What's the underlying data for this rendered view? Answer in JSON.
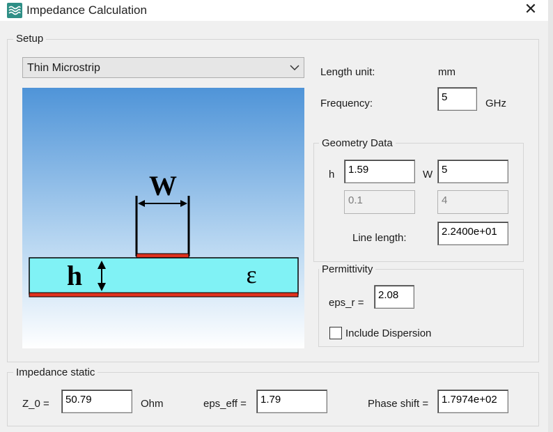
{
  "window": {
    "title": "Impedance Calculation",
    "close_glyph": "✕",
    "app_icon": "impedance-app-icon"
  },
  "setup": {
    "legend": "Setup",
    "line_type": "Thin Microstrip",
    "length_unit_label": "Length unit:",
    "length_unit_value": "mm",
    "frequency_label": "Frequency:",
    "frequency_value": "5",
    "frequency_unit": "GHz"
  },
  "diagram": {
    "w_label": "W",
    "h_label": "h",
    "epsilon_label": "ε",
    "colors": {
      "substrate": "#80f2f5",
      "conductor": "#e0321e",
      "sky_top": "#4f94d8",
      "sky_bottom": "#ffffff"
    }
  },
  "geometry": {
    "legend": "Geometry Data",
    "h_label": "h",
    "h_value": "1.59",
    "w_label": "W",
    "w_value": "5",
    "h_tol": "0.1",
    "w_tol": "4",
    "line_length_label": "Line length:",
    "line_length_value": "2.2400e+01"
  },
  "permittivity": {
    "legend": "Permittivity",
    "eps_r_label": "eps_r =",
    "eps_r_value": "2.08",
    "dispersion_label": "Include Dispersion",
    "dispersion_checked": false
  },
  "results": {
    "legend": "Impedance static",
    "z0_label": "Z_0 =",
    "z0_value": "50.79",
    "z0_unit": "Ohm",
    "eps_eff_label": "eps_eff =",
    "eps_eff_value": "1.79",
    "phase_label": "Phase shift =",
    "phase_value": "1.7974e+02"
  }
}
